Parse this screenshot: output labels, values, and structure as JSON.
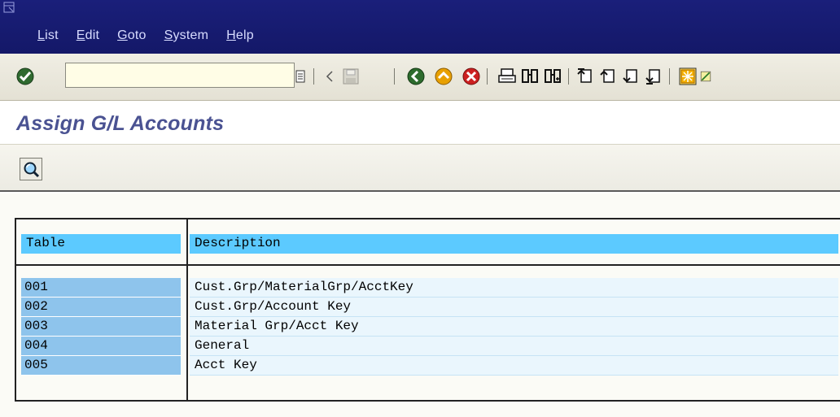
{
  "menubar": {
    "items": [
      {
        "accel": "L",
        "rest": "ist"
      },
      {
        "accel": "E",
        "rest": "dit"
      },
      {
        "accel": "G",
        "rest": "oto"
      },
      {
        "accel": "S",
        "rest": "ystem"
      },
      {
        "accel": "H",
        "rest": "elp"
      }
    ]
  },
  "toolbar": {
    "command_value": "",
    "icons": [
      "enter-check-icon",
      "command-history-icon",
      "back-arrow-icon",
      "save-icon",
      "back-icon",
      "exit-icon",
      "cancel-icon",
      "print-icon",
      "find-icon",
      "find-next-icon",
      "first-page-icon",
      "previous-page-icon",
      "next-page-icon",
      "last-page-icon",
      "create-session-icon"
    ]
  },
  "page": {
    "title": "Assign G/L Accounts"
  },
  "app_toolbar": {
    "icons": [
      "details-magnify-icon"
    ]
  },
  "table": {
    "headers": {
      "table": "Table",
      "description": "Description"
    },
    "rows": [
      {
        "table": "001",
        "description": "Cust.Grp/MaterialGrp/AcctKey"
      },
      {
        "table": "002",
        "description": "Cust.Grp/Account Key"
      },
      {
        "table": "003",
        "description": "Material Grp/Acct Key"
      },
      {
        "table": "004",
        "description": "General"
      },
      {
        "table": "005",
        "description": "Acct Key"
      }
    ]
  },
  "colors": {
    "menubar": "#1a1f7a",
    "header_cell": "#5ccaff",
    "key_cell": "#8ec4ec",
    "title": "#4a5292"
  }
}
